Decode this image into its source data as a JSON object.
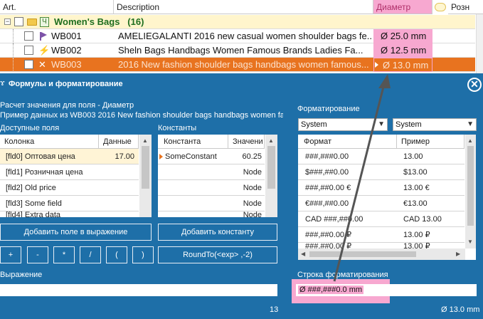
{
  "grid": {
    "headers": {
      "art": "Art.",
      "description": "Description",
      "diameter": "Диаметр",
      "roz": "Розн"
    },
    "group": {
      "label": "Women's Bags",
      "count": "(16)"
    },
    "rows": [
      {
        "art": "WB001",
        "description": "AMELIEGALANTI 2016 new casual women shoulder bags fe...",
        "diameter": "Ø 25.0 mm"
      },
      {
        "art": "WB002",
        "description": "Sheln Bags Handbags Women Famous Brands Ladies Fa...",
        "diameter": "Ø 12.5 mm"
      },
      {
        "art": "WB003",
        "description": "2016 New fashion shoulder bags handbags women famous...",
        "diameter": "Ø 13.0 mm"
      }
    ]
  },
  "dialog": {
    "title": "Формулы и форматирование",
    "calc_label": "Расчет значения для поля - Диаметр",
    "sample_label": "Пример данных из   WB003 2016 New fashion shoulder bags handbags women fam",
    "available_fields": {
      "title": "Доступные поля",
      "col_name": "Колонка",
      "col_data": "Данные",
      "rows": [
        {
          "name": "[fld0] Оптовая цена",
          "data": "17.00"
        },
        {
          "name": "[fld1] Розничная цена",
          "data": ""
        },
        {
          "name": "[fld2] Old price",
          "data": ""
        },
        {
          "name": "[fld3] Some field",
          "data": ""
        },
        {
          "name": "[fld4] Extra data",
          "data": ""
        }
      ]
    },
    "constants": {
      "title": "Константы",
      "col_name": "Константа",
      "col_value": "Значени",
      "rows": [
        {
          "name": "SomeConstant",
          "value": "60.25"
        },
        {
          "name": "",
          "value": "Node"
        },
        {
          "name": "",
          "value": "Node"
        },
        {
          "name": "",
          "value": "Node"
        },
        {
          "name": "",
          "value": "Node"
        }
      ]
    },
    "buttons": {
      "add_field": "Добавить поле в выражение",
      "add_constant": "Добавить константу",
      "plus": "+",
      "minus": "-",
      "mul": "*",
      "div": "/",
      "lparen": "(",
      "rparen": ")",
      "round": "RoundTo(<exp> ,-2)"
    },
    "expression_label": "Выражение",
    "expression_value": "",
    "expression_length": "13",
    "formatting": {
      "title": "Форматирование",
      "select1": "System",
      "select2": "System",
      "col_format": "Формат",
      "col_example": "Пример",
      "rows": [
        {
          "format": "###,###0.00",
          "example": "13.00"
        },
        {
          "format": "$###,##0.00",
          "example": "$13.00"
        },
        {
          "format": "###,##0.00 €",
          "example": "13.00 €"
        },
        {
          "format": "€###,##0.00",
          "example": "€13.00"
        },
        {
          "format": "CAD ###,##0.00",
          "example": "CAD 13.00"
        },
        {
          "format": "###,##0.00 ₽",
          "example": "13.00 ₽"
        },
        {
          "format": "###,##0.00 ₽",
          "example": "13.00 ₽"
        }
      ],
      "format_string_label": "Строка форматирования",
      "format_string_value": "Ø ###,###0.0 mm",
      "preview": "Ø 13.0 mm"
    },
    "colors": {
      "dialog_bg": "#1e6fa8",
      "selected_row": "#e8731f",
      "highlight": "#f7a8d0",
      "arrow": "#555555"
    }
  }
}
